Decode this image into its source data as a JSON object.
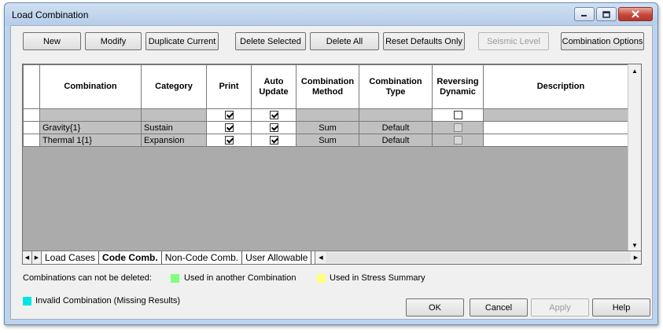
{
  "window": {
    "title": "Load Combination",
    "minimize_icon": "minimize-icon",
    "maximize_icon": "maximize-icon",
    "close_icon": "close-icon"
  },
  "toolbar": {
    "new": "New",
    "modify": "Modify",
    "duplicate": "Duplicate Current",
    "delete_selected": "Delete Selected",
    "delete_all": "Delete All",
    "reset_defaults": "Reset Defaults Only",
    "seismic_level": "Seismic Level",
    "combination_options": "Combination Options"
  },
  "grid": {
    "columns": [
      "Combination",
      "Category",
      "Print",
      "Auto Update",
      "Combination Method",
      "Combination Type",
      "Reversing Dynamic",
      "Description"
    ],
    "rows": [
      {
        "combination": "",
        "category": "",
        "print": true,
        "auto_update": true,
        "method": "",
        "type": "",
        "reversing": false,
        "description": ""
      },
      {
        "combination": "Gravity{1}",
        "category": "Sustain",
        "print": true,
        "auto_update": true,
        "method": "Sum",
        "type": "Default",
        "reversing": false,
        "description": ""
      },
      {
        "combination": "Thermal 1{1}",
        "category": "Expansion",
        "print": true,
        "auto_update": true,
        "method": "Sum",
        "type": "Default",
        "reversing": false,
        "description": ""
      }
    ]
  },
  "tabs": [
    {
      "label": "Load Cases",
      "active": false
    },
    {
      "label": "Code Comb.",
      "active": true
    },
    {
      "label": "Non-Code Comb.",
      "active": false
    },
    {
      "label": "User Allowable",
      "active": false
    }
  ],
  "legend": {
    "cannot_delete": "Combinations can not be deleted:",
    "used_in_combination": "Used in another Combination",
    "used_in_stress": "Used in Stress Summary",
    "invalid": "Invalid Combination (Missing Results)",
    "colors": {
      "green": "#80ff80",
      "yellow": "#ffff80",
      "cyan": "#00e6e6"
    }
  },
  "footer": {
    "ok": "OK",
    "cancel": "Cancel",
    "apply": "Apply",
    "help": "Help"
  }
}
